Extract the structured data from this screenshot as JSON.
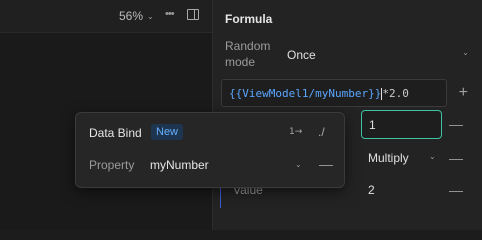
{
  "toolbar": {
    "zoom": "56%",
    "zoom_chevron": "⌄",
    "more": "•••"
  },
  "formula": {
    "title": "Formula",
    "random_label": "Random mode",
    "random_value": "Once",
    "expression_ref": "{{ViewModel1/myNumber}}",
    "expression_tail": "*2.0",
    "plus": "+",
    "input_value": "1",
    "operation": "Multiply",
    "value_label": "Value",
    "value": "2",
    "minus": "—"
  },
  "popover": {
    "title": "Data Bind",
    "badge": "New",
    "bind_icon": "1→",
    "path_icon": "./",
    "property_label": "Property",
    "property_value": "myNumber"
  },
  "icons": {
    "chevron": "⌄",
    "panel_toggle": "panel-icon"
  },
  "colors": {
    "accent_green": "#3fc3a1",
    "link_blue": "#5aa6ff",
    "badge_bg": "#1e3550"
  }
}
